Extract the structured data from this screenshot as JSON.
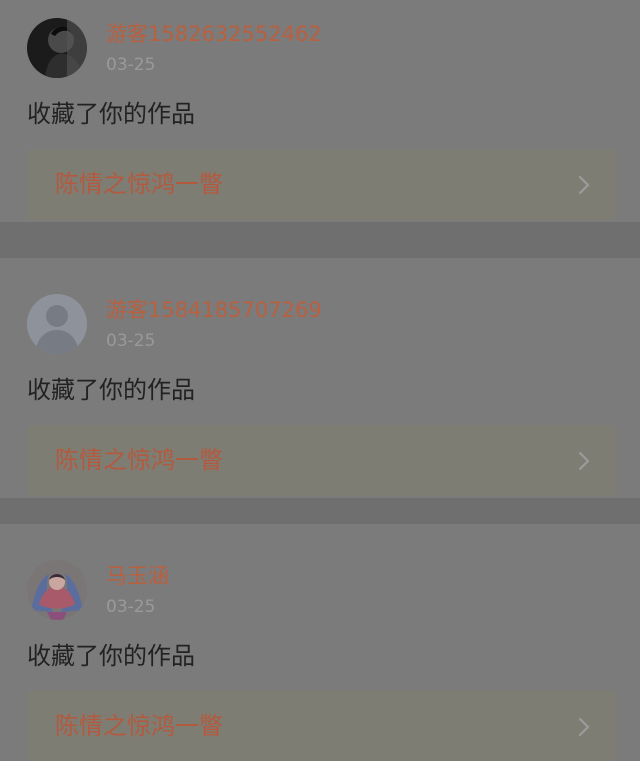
{
  "notifications": [
    {
      "username": "游客1582632552462",
      "date": "03-25",
      "action": "收藏了你的作品",
      "work_title": "陈情之惊鸿一瞥",
      "avatar_icon": "dark-photo-avatar"
    },
    {
      "username": "游客1584185707269",
      "date": "03-25",
      "action": "收藏了你的作品",
      "work_title": "陈情之惊鸿一瞥",
      "avatar_icon": "default-user-avatar"
    },
    {
      "username": "马玉涵",
      "date": "03-25",
      "action": "收藏了你的作品",
      "work_title": "陈情之惊鸿一瞥",
      "avatar_icon": "illustrated-character-avatar"
    }
  ],
  "colors": {
    "overlay_background": "#6f6f6f",
    "username": "#b8603f",
    "work_title": "#b35a3e",
    "date": "#9a9a9a",
    "action_text": "#222222"
  }
}
